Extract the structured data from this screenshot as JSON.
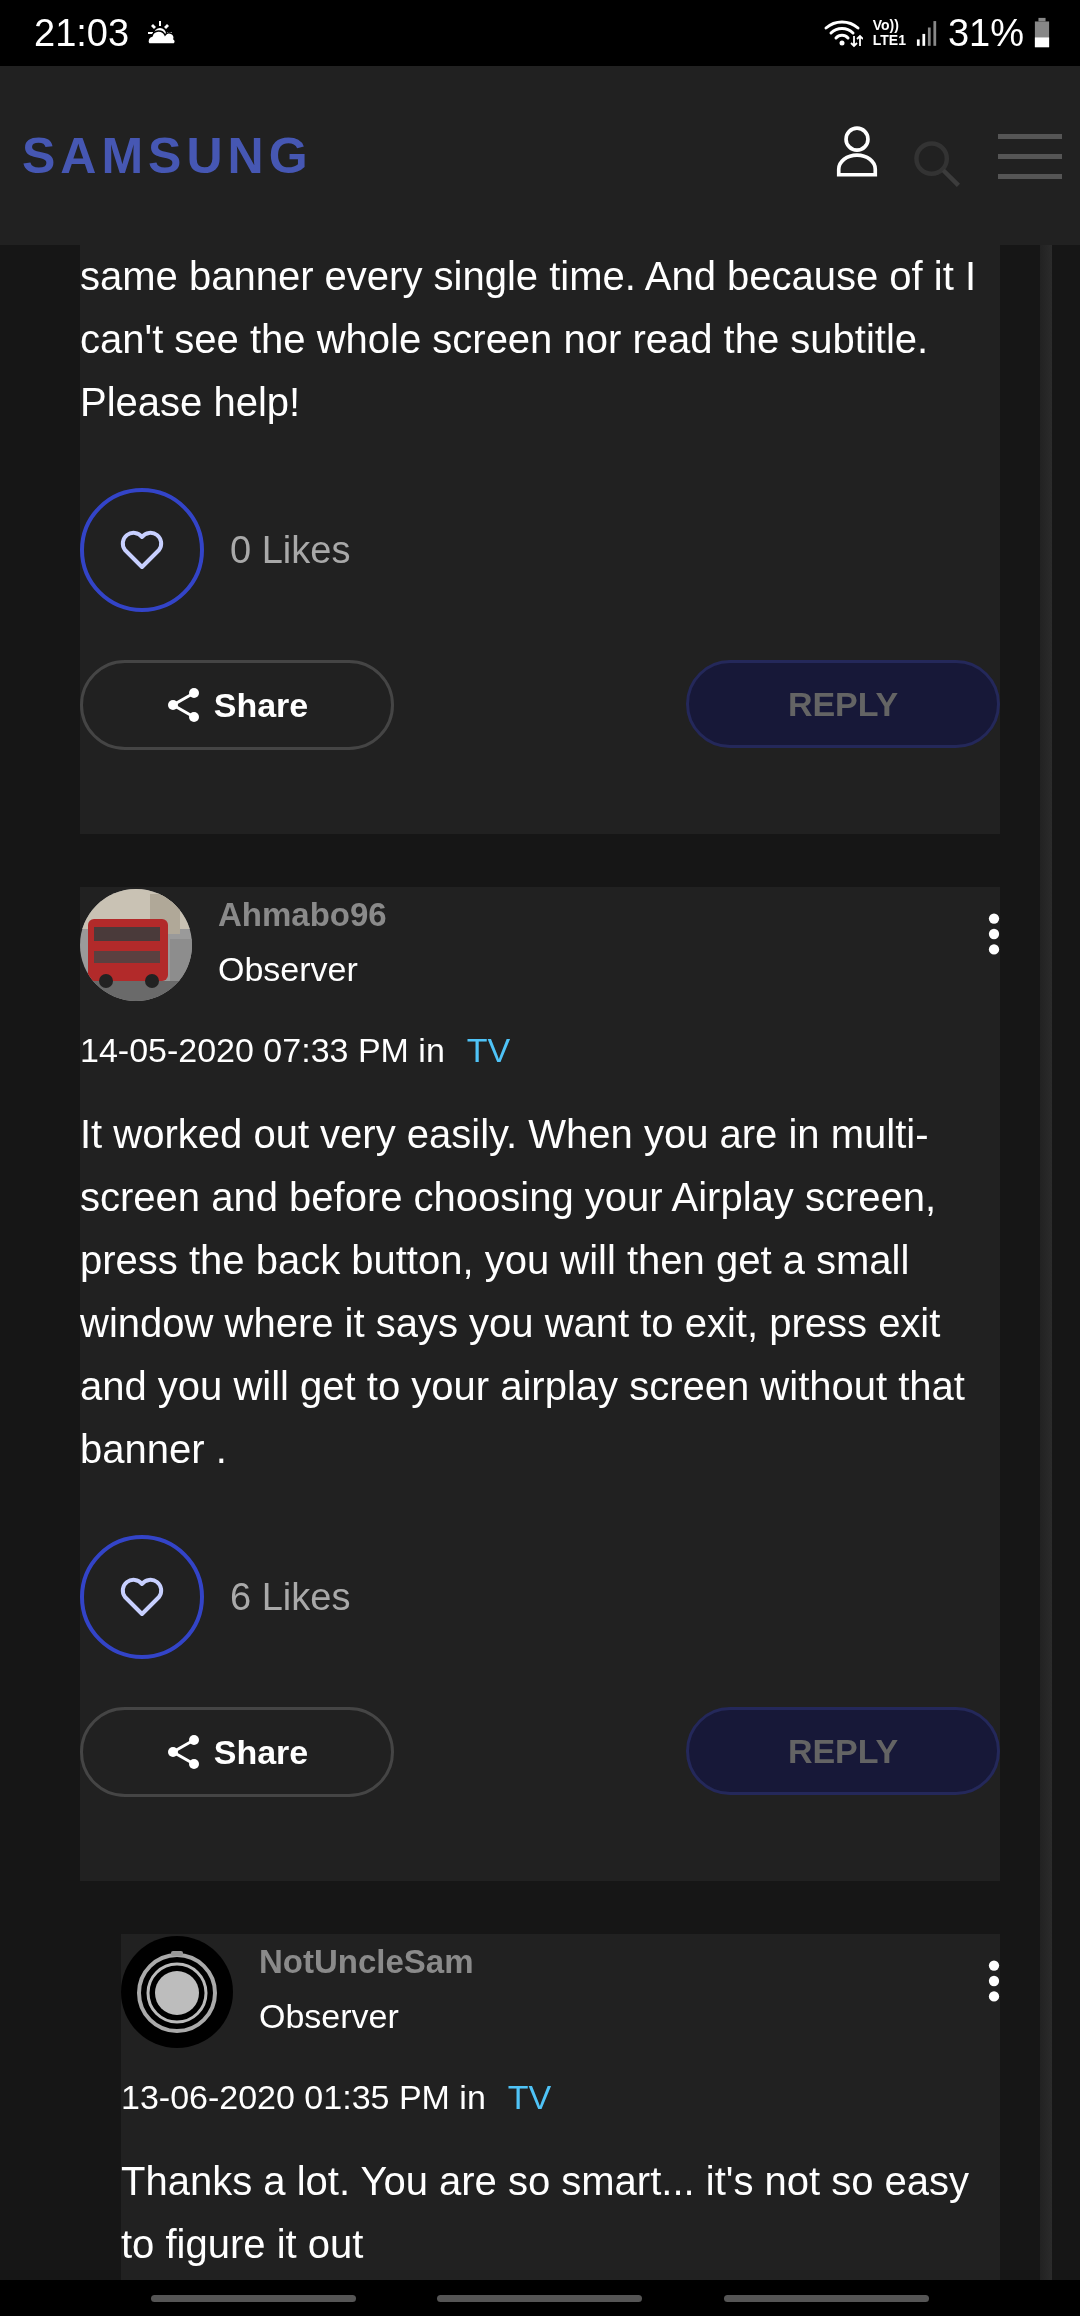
{
  "status_bar": {
    "time": "21:03",
    "volte": "Vo))",
    "network": "LTE1",
    "battery": "31%"
  },
  "header": {
    "logo": "SAMSUNG"
  },
  "posts": [
    {
      "kind": "post",
      "body": "same banner every single time. And because of it I can't see the whole screen nor read the subtitle. Please help!",
      "likes": "0 Likes",
      "share": "Share",
      "reply": {
        "label": "REPLY",
        "disabled": true
      }
    },
    {
      "kind": "post",
      "author": {
        "name": "Ahmabo96",
        "rank": "Observer"
      },
      "date": "14-05-2020 07:33 PM in",
      "board": "TV",
      "body": "It worked out very easily. When you are in multi-screen and before choosing your Airplay screen, press the back button, you will then get a small window where it says you want to exit, press exit and you will get to your airplay screen without that banner .",
      "likes": "6 Likes",
      "share": "Share",
      "reply": {
        "label": "REPLY",
        "disabled": true
      }
    },
    {
      "kind": "reply",
      "author": {
        "name": "NotUncleSam",
        "rank": "Observer",
        "avatar": {
          "kind": "icon"
        }
      },
      "date": "13-06-2020 01:35 PM in",
      "board": "TV",
      "body": "Thanks a lot. You are so smart... it's not so easy to figure it out"
    }
  ]
}
